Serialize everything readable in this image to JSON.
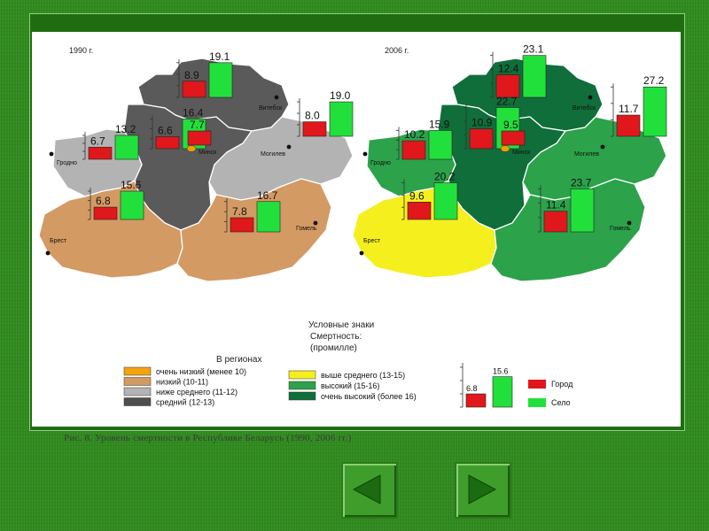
{
  "maps": [
    {
      "year_label": "1990 г.",
      "regions": [
        {
          "key": "vitebsk",
          "city": "Витебск",
          "gorod": 8.9,
          "selo": 19.1,
          "gorod_label": "8.9",
          "selo_label": "19.1",
          "fill": "#5a5a5a"
        },
        {
          "key": "minsk",
          "city": "Минск",
          "gorod": 6.6,
          "selo": 16.4,
          "gorod_label": "6.6",
          "selo_label": "16.4",
          "extra_label": "7.7",
          "fill": "#5a5a5a"
        },
        {
          "key": "grodno",
          "city": "Гродно",
          "gorod": 6.7,
          "selo": 13.2,
          "gorod_label": "6.7",
          "selo_label": "13.2",
          "fill": "#b3b3b3"
        },
        {
          "key": "mogilev",
          "city": "Могилев",
          "gorod": 8.0,
          "selo": 19.0,
          "gorod_label": "8.0",
          "selo_label": "19.0",
          "fill": "#b3b3b3"
        },
        {
          "key": "brest",
          "city": "Брест",
          "gorod": 6.8,
          "selo": 15.6,
          "gorod_label": "6.8",
          "selo_label": "15.6",
          "fill": "#d39a63"
        },
        {
          "key": "gomel",
          "city": "Гомель",
          "gorod": 7.8,
          "selo": 16.7,
          "gorod_label": "7.8",
          "selo_label": "16.7",
          "fill": "#d39a63"
        }
      ]
    },
    {
      "year_label": "2006 г.",
      "regions": [
        {
          "key": "vitebsk",
          "city": "Витебск",
          "gorod": 12.4,
          "selo": 23.1,
          "gorod_label": "12.4",
          "selo_label": "23.1",
          "fill": "#0f6e3a"
        },
        {
          "key": "minsk",
          "city": "Минск",
          "gorod": 10.9,
          "selo": 22.7,
          "gorod_label": "10.9",
          "selo_label": "22.7",
          "extra_label": "9.5",
          "fill": "#0f6e3a"
        },
        {
          "key": "grodno",
          "city": "Гродно",
          "gorod": 10.2,
          "selo": 15.9,
          "gorod_label": "10.2",
          "selo_label": "15.9",
          "fill": "#2ca24a"
        },
        {
          "key": "mogilev",
          "city": "Могилев",
          "gorod": 11.7,
          "selo": 27.2,
          "gorod_label": "11.7",
          "selo_label": "27.2",
          "fill": "#2ca24a"
        },
        {
          "key": "brest",
          "city": "Брест",
          "gorod": 9.6,
          "selo": 20.2,
          "gorod_label": "9.6",
          "selo_label": "20.2",
          "fill": "#f5ef1e"
        },
        {
          "key": "gomel",
          "city": "Гомель",
          "gorod": 11.4,
          "selo": 23.7,
          "gorod_label": "11.4",
          "selo_label": "23.7",
          "fill": "#2ca24a"
        }
      ]
    }
  ],
  "colors": {
    "gorod": "#e0171b",
    "selo": "#22e03c",
    "capital_fill": "#f0a000"
  },
  "legend": {
    "title": "Условные    знаки",
    "subtitle": "Смертность:",
    "unit": "(промилле)",
    "regions_title": "В регионах",
    "items_left": [
      {
        "label": "очень низкий (менее 10)",
        "color": "#f5a20f"
      },
      {
        "label": "низкий (10-11)",
        "color": "#d39a63"
      },
      {
        "label": "ниже среднего (11-12)",
        "color": "#b3b3b3"
      },
      {
        "label": "средний (12-13)",
        "color": "#4f4f4f"
      }
    ],
    "items_right": [
      {
        "label": "выше среднего (13-15)",
        "color": "#f5ef1e"
      },
      {
        "label": "высокий (15-16)",
        "color": "#2ca24a"
      },
      {
        "label": "очень высокий (более 16)",
        "color": "#0f6e3a"
      }
    ],
    "sample": {
      "gorod": 6.8,
      "selo": 15.6,
      "gorod_label": "6.8",
      "selo_label": "15.6"
    },
    "gorod_label": "Город",
    "selo_label": "Село"
  },
  "caption": "Рис. 8. Уровень смертности в Республике Беларусь (1990, 2006 гг.)"
}
